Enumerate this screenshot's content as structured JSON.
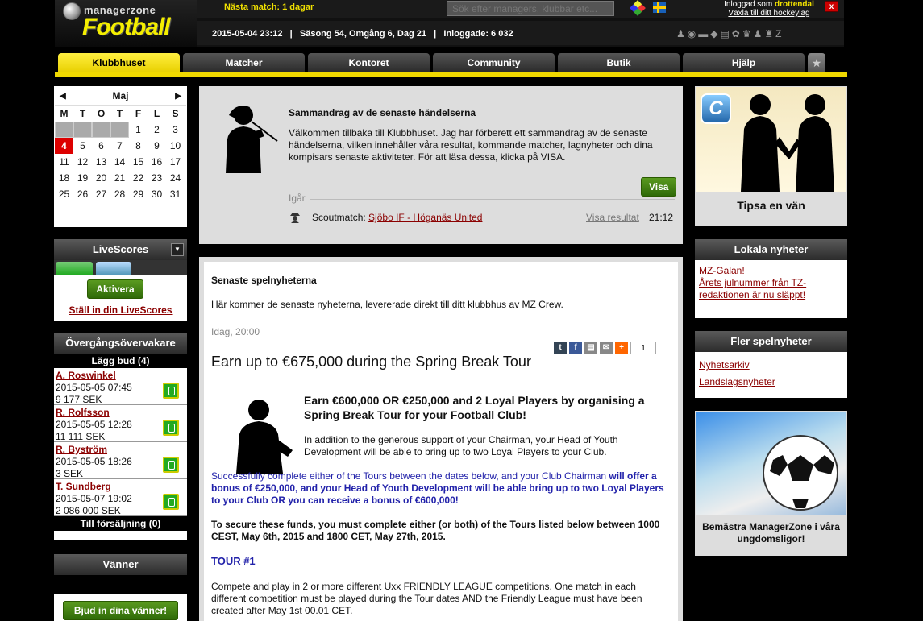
{
  "header": {
    "logo_small": "managerzone",
    "logo_big": "Football",
    "next_match": "Nästa match: 1 dagar",
    "search_placeholder": "Sök efter managers, klubbar etc...",
    "login_prefix": "Inloggad som",
    "username": "drottendal",
    "switch_link": "Växla till ditt hockeylag",
    "close": "x",
    "status": "2015-05-04 23:12   |   Säsong 54, Omgång 6, Dag 21   |   Inloggade: 6 032",
    "status_icons": "♟◉▬◆▤✿♛♟♜Z"
  },
  "nav": {
    "tabs": [
      "Klubbhuset",
      "Matcher",
      "Kontoret",
      "Community",
      "Butik",
      "Hjälp"
    ],
    "active": 0,
    "extra_icon": "star-icon"
  },
  "calendar": {
    "month": "Maj",
    "prev": "◀",
    "next": "▶",
    "days_of_week": [
      "M",
      "T",
      "O",
      "T",
      "F",
      "L",
      "S"
    ],
    "leading_empty": 4,
    "days": 31,
    "today": 4
  },
  "livescores": {
    "title": "LiveScores",
    "activate": "Aktivera",
    "setup_link": "Ställ in din LiveScores"
  },
  "transfer": {
    "title": "Övergångsövervakare",
    "bids_header": "Lägg bud (4)",
    "bids": [
      {
        "name": "A. Roswinkel",
        "date": "2015-05-05 07:45",
        "price": "9 177 SEK"
      },
      {
        "name": "R. Rolfsson",
        "date": "2015-05-05 12:28",
        "price": "11 111 SEK"
      },
      {
        "name": "R. Byström",
        "date": "2015-05-05 18:26",
        "price": "3 SEK"
      },
      {
        "name": "T. Sundberg",
        "date": "2015-05-07 19:02",
        "price": "2 086 000 SEK"
      }
    ],
    "for_sale": "Till försäljning (0)"
  },
  "friends": {
    "title": "Vänner",
    "invite": "Bjud in dina vänner!"
  },
  "summary": {
    "title": "Sammandrag av de senaste händelserna",
    "text": "Välkommen tillbaka till Klubbhuset. Jag har förberett ett sammandrag av de senaste händelserna, vilken innehåller våra resultat, kommande matcher, lagnyheter och dina kompisars senaste aktiviteter. För att läsa dessa, klicka på VISA.",
    "visa": "Visa",
    "group": "Igår",
    "event_prefix": "Scoutmatch:",
    "event_link": "Sjöbo IF - Höganäs United",
    "result_link": "Visa resultat",
    "time": "21:12"
  },
  "news": {
    "heading": "Senaste spelnyheterna",
    "intro": "Här kommer de senaste nyheterna, levererade direkt till ditt klubbhus av MZ Crew.",
    "date": "Idag, 20:00",
    "share_count": "1",
    "title": "Earn up to €675,000 during the Spring Break Tour",
    "subtitle": "Earn €600,000 OR €250,000 and 2 Loyal Players by organising a Spring Break Tour for your Football Club!",
    "p1": "In addition to the generous support of your Chairman, your Head of Youth Development will be able to bring up to two Loyal Players to your Club.",
    "p2a": "Successfully complete either of the Tours between the dates below, and your Club Chairman ",
    "p2b": "will offer a bonus of €250,000, and your Head of Youth Development will be able bring up to two Loyal Players to your Club OR you can receive a bonus of €600,000!",
    "p3": "To secure these funds, you must complete either (or both) of the Tours listed below between 1000 CEST, May 6th, 2015 and 1800 CET, May 27th, 2015.",
    "tour": "TOUR #1",
    "p4": "Compete and play in 2 or more different Uxx FRIENDLY LEAGUE competitions. One match in each different competition must be played during the Tour dates AND the Friendly League must have been created after May 1st 00.01 CET."
  },
  "right": {
    "tipsa_badge": "C",
    "tipsa": "Tipsa en vän",
    "lokala_title": "Lokala nyheter",
    "lokala_items": [
      "MZ-Galan!",
      "Årets julnummer från TZ-redaktionen är nu släppt!"
    ],
    "fler_title": "Fler spelnyheter",
    "fler_items": [
      "Nyhetsarkiv",
      "Landslagsnyheter"
    ],
    "ungdom": "Bemästra ManagerZone i våra ungdomsligor!"
  }
}
